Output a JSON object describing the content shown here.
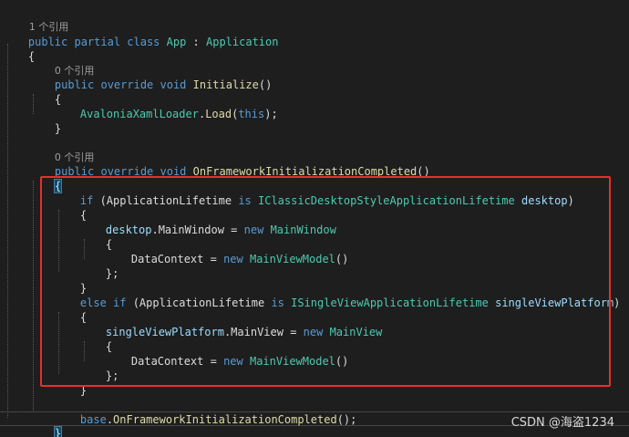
{
  "editor": {
    "lines": {
      "ref1": "1 个引用",
      "class_decl": "public partial class App : Application",
      "brace_open_class": "{",
      "ref2": "0 个引用",
      "init_sig": "public override void Initialize()",
      "brace_open_init": "{",
      "loader_call": "AvaloniaXamlLoader.Load(this);",
      "brace_close_init": "}",
      "ref3": "0 个引用",
      "framework_sig": "public override void OnFrameworkInitializationCompleted()",
      "brace_open_framework": "{",
      "if_desktop": "if (ApplicationLifetime is IClassicDesktopStyleApplicationLifetime desktop)",
      "brace_open_if": "{",
      "desktop_main_window": "desktop.MainWindow = new MainWindow",
      "brace_open_init_obj1": "{",
      "datacontext1": "DataContext = new MainViewModel()",
      "brace_close_init_obj1": "};",
      "brace_close_if": "}",
      "else_if_single": "else if (ApplicationLifetime is ISingleViewApplicationLifetime singleViewPlatform)",
      "brace_open_else": "{",
      "single_main_view": "singleViewPlatform.MainView = new MainView",
      "brace_open_init_obj2": "{",
      "datacontext2": "DataContext = new MainViewModel()",
      "brace_close_init_obj2": "};",
      "brace_close_else": "}",
      "base_call": "base.OnFrameworkInitializationCompleted();",
      "brace_close_framework": "}",
      "brace_close_class": "}"
    }
  },
  "watermark": "CSDN @海盗1234",
  "colors": {
    "background": "#1e1e1e",
    "keyword": "#569cd6",
    "type": "#4ec9b0",
    "method": "#dcdcaa",
    "parameter": "#9cdcfe",
    "highlight_border": "#e5312a"
  }
}
